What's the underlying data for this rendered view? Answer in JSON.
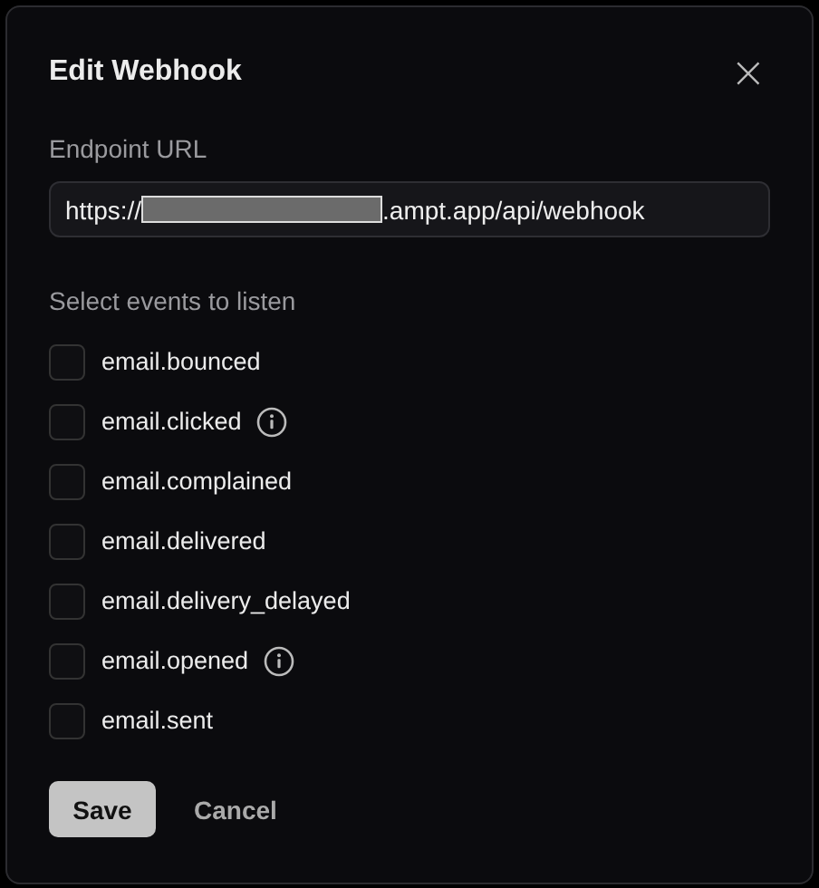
{
  "dialog": {
    "title": "Edit Webhook",
    "close": "×"
  },
  "endpoint": {
    "label": "Endpoint URL",
    "value_before": "https://",
    "redacted": true,
    "value_after": ".ampt.app/api/webhook"
  },
  "events_label": "Select events to listen",
  "events": [
    {
      "name": "email.bounced",
      "checked": false,
      "info": false
    },
    {
      "name": "email.clicked",
      "checked": false,
      "info": true
    },
    {
      "name": "email.complained",
      "checked": false,
      "info": false
    },
    {
      "name": "email.delivered",
      "checked": false,
      "info": false
    },
    {
      "name": "email.delivery_delayed",
      "checked": false,
      "info": false
    },
    {
      "name": "email.opened",
      "checked": false,
      "info": true
    },
    {
      "name": "email.sent",
      "checked": false,
      "info": false
    }
  ],
  "buttons": [
    "Save",
    "Cancel"
  ]
}
